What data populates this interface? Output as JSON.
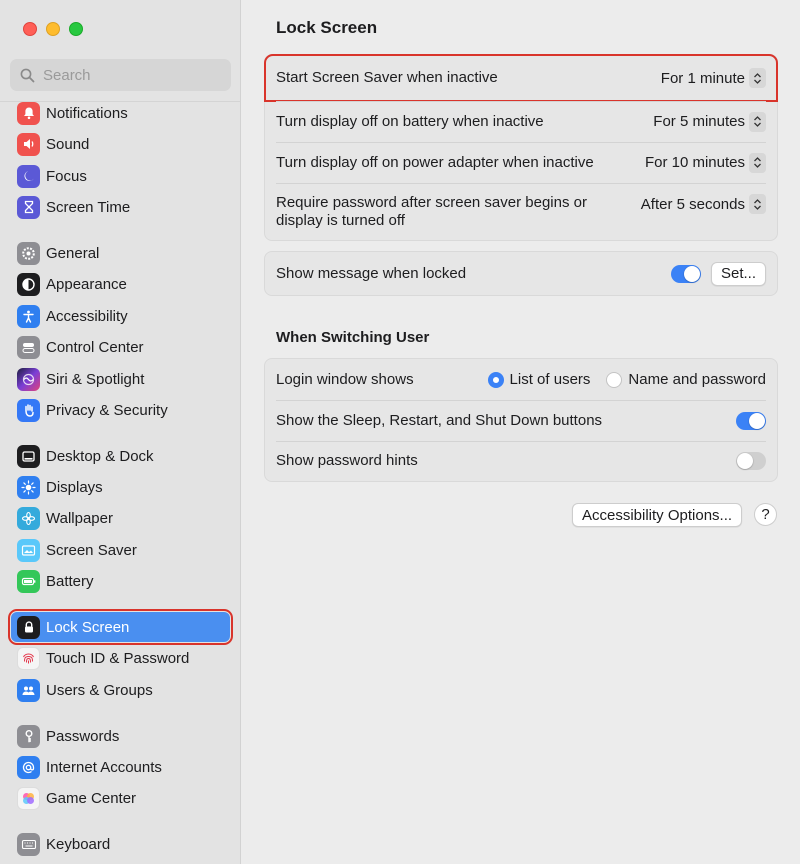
{
  "window": {
    "title": "Lock Screen"
  },
  "search": {
    "placeholder": "Search"
  },
  "sidebar": {
    "items": [
      {
        "label": "Notifications",
        "icon": "bell-icon",
        "color": "#f0524e"
      },
      {
        "label": "Sound",
        "icon": "speaker-icon",
        "color": "#f0524e"
      },
      {
        "label": "Focus",
        "icon": "moon-icon",
        "color": "#5b59d6"
      },
      {
        "label": "Screen Time",
        "icon": "hourglass-icon",
        "color": "#5b59d6"
      },
      {
        "label": "General",
        "icon": "gear-icon",
        "color": "#8e8e93"
      },
      {
        "label": "Appearance",
        "icon": "appearance-icon",
        "color": "#1d1d1f"
      },
      {
        "label": "Accessibility",
        "icon": "accessibility-icon",
        "color": "#2f7ff0"
      },
      {
        "label": "Control Center",
        "icon": "toggles-icon",
        "color": "#8e8e93"
      },
      {
        "label": "Siri & Spotlight",
        "icon": "siri-icon",
        "color": "#7b3fd6"
      },
      {
        "label": "Privacy & Security",
        "icon": "hand-icon",
        "color": "#3478f6"
      },
      {
        "label": "Desktop & Dock",
        "icon": "dock-icon",
        "color": "#1d1d1f"
      },
      {
        "label": "Displays",
        "icon": "sun-icon",
        "color": "#2f7ff0"
      },
      {
        "label": "Wallpaper",
        "icon": "flower-icon",
        "color": "#34aadc"
      },
      {
        "label": "Screen Saver",
        "icon": "screensaver-icon",
        "color": "#5ac8fa"
      },
      {
        "label": "Battery",
        "icon": "battery-icon",
        "color": "#34c759"
      },
      {
        "label": "Lock Screen",
        "icon": "lock-icon",
        "color": "#1d1d1f",
        "active": true
      },
      {
        "label": "Touch ID & Password",
        "icon": "fingerprint-icon",
        "color": "#f5f5f5"
      },
      {
        "label": "Users & Groups",
        "icon": "users-icon",
        "color": "#2f7ff0"
      },
      {
        "label": "Passwords",
        "icon": "key-icon",
        "color": "#8e8e93"
      },
      {
        "label": "Internet Accounts",
        "icon": "at-icon",
        "color": "#2f7ff0"
      },
      {
        "label": "Game Center",
        "icon": "gamecenter-icon",
        "color": "#f5f5f5"
      },
      {
        "label": "Keyboard",
        "icon": "keyboard-icon",
        "color": "#8e8e93"
      }
    ]
  },
  "main": {
    "title": "Lock Screen",
    "settings": [
      {
        "label": "Start Screen Saver when inactive",
        "value": "For 1 minute"
      },
      {
        "label": "Turn display off on battery when inactive",
        "value": "For 5 minutes"
      },
      {
        "label": "Turn display off on power adapter when inactive",
        "value": "For 10 minutes"
      },
      {
        "label": "Require password after screen saver begins or display is turned off",
        "value": "After 5 seconds"
      }
    ],
    "message": {
      "label": "Show message when locked",
      "toggle": true,
      "button": "Set..."
    },
    "switching": {
      "title": "When Switching User",
      "login_label": "Login window shows",
      "option_list": "List of users",
      "option_name": "Name and password",
      "selected": "List of users",
      "sleep_label": "Show the Sleep, Restart, and Shut Down buttons",
      "sleep_toggle": true,
      "hints_label": "Show password hints",
      "hints_toggle": false
    },
    "accessibility_button": "Accessibility Options...",
    "help": "?"
  },
  "colors": {
    "accent": "#3b82f6",
    "highlight": "#d9342b"
  }
}
